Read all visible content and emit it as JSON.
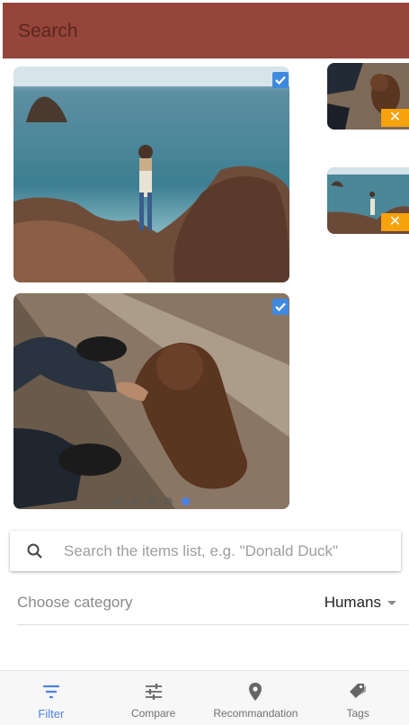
{
  "appbar": {
    "title": "Search"
  },
  "gallery": {
    "cards": [
      {
        "alt": "woman-on-rocks-photo",
        "selected": true
      },
      {
        "alt": "dog-paw-photo",
        "selected": true
      }
    ],
    "pager": {
      "count": 5,
      "active_index": 4
    },
    "thumbnails": [
      {
        "alt": "dog-paw-thumbnail",
        "remove_label": "✕"
      },
      {
        "alt": "woman-on-rocks-thumbnail",
        "remove_label": "✕"
      }
    ]
  },
  "search": {
    "placeholder": "Search the items list, e.g. \"Donald Duck\"",
    "value": "",
    "icon": "search-icon"
  },
  "category": {
    "label": "Choose category",
    "value": "Humans"
  },
  "bottom_nav": {
    "items": [
      {
        "label": "Filter",
        "icon": "filter-icon",
        "active": true
      },
      {
        "label": "Compare",
        "icon": "sliders-icon",
        "active": false
      },
      {
        "label": "Recommandation",
        "icon": "location-pin-icon",
        "active": false
      },
      {
        "label": "Tags",
        "icon": "tags-icon",
        "active": false
      }
    ]
  },
  "colors": {
    "appbar": "#95453a",
    "accent": "#4c82e6",
    "remove_badge": "#f5a20c"
  }
}
